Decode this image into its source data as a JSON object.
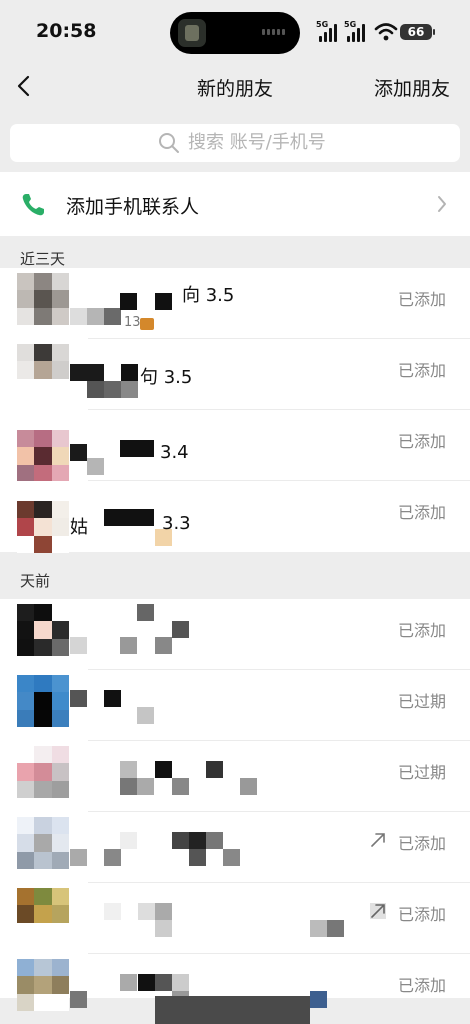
{
  "status_bar": {
    "time": "20:58",
    "network_1": "5G",
    "network_2": "5G",
    "battery": "66"
  },
  "nav": {
    "title": "新的朋友",
    "action": "添加朋友"
  },
  "search": {
    "placeholder": "搜索 账号/手机号"
  },
  "contacts_row": {
    "label": "添加手机联系人"
  },
  "sections": {
    "recent": "近三天",
    "earlier": "天前"
  },
  "friends_recent": [
    {
      "name_visible": "向 3.5",
      "extra": "13",
      "status": "已添加"
    },
    {
      "name_visible": "句 3.5",
      "status": "已添加"
    },
    {
      "name_visible": "3.4",
      "status": "已添加"
    },
    {
      "name_visible": "3.3",
      "prefix": "姑",
      "status": "已添加"
    }
  ],
  "friends_earlier": [
    {
      "status": "已添加"
    },
    {
      "status": "已过期"
    },
    {
      "status": "已过期"
    },
    {
      "status": "已添加",
      "forwarded": true
    },
    {
      "status": "已添加",
      "forwarded": true
    },
    {
      "status": "已添加"
    }
  ],
  "colors": {
    "background": "#ededed",
    "card": "#ffffff",
    "status_text": "#888888",
    "phone_icon": "#2aae67"
  },
  "icons": {
    "back": "chevron-left-icon",
    "search": "search-icon",
    "phone": "phone-icon",
    "chevron": "chevron-right-icon",
    "forward": "forward-arrow-icon"
  }
}
